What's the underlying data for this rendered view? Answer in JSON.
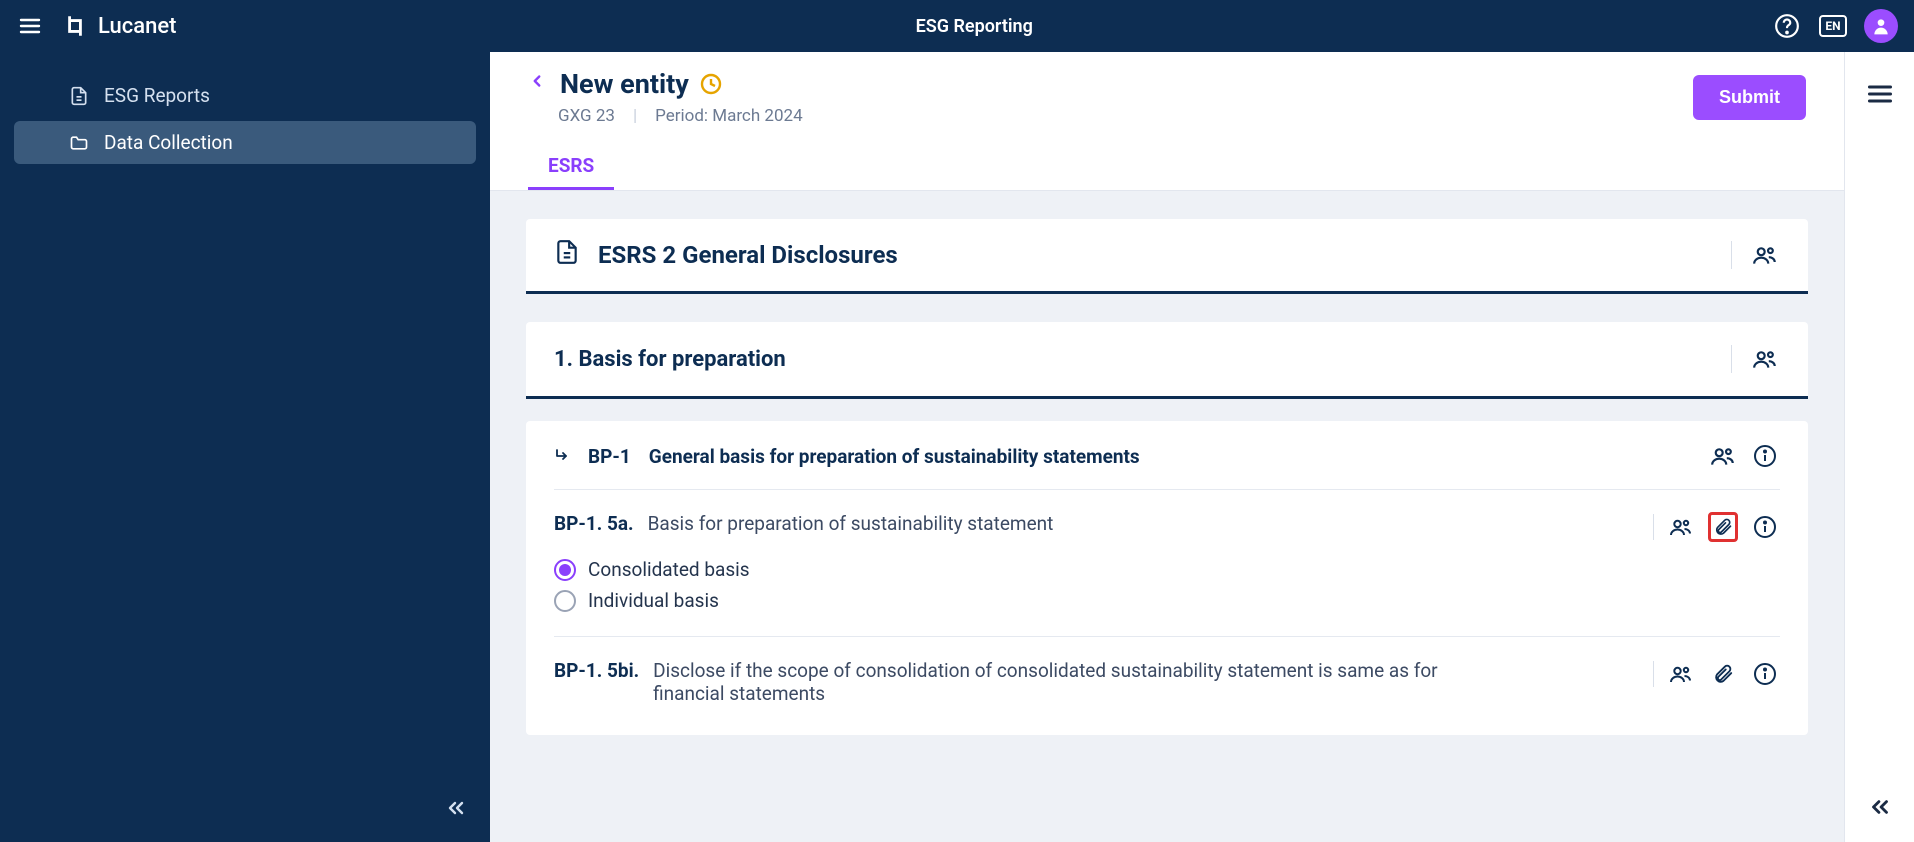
{
  "brand": "Lucanet",
  "app_title": "ESG Reporting",
  "lang": "EN",
  "sidebar": {
    "items": [
      {
        "label": "ESG Reports"
      },
      {
        "label": "Data Collection"
      }
    ]
  },
  "header": {
    "title": "New entity",
    "entity_code": "GXG 23",
    "period_label": "Period: March 2024",
    "submit_label": "Submit"
  },
  "tabs": [
    {
      "label": "ESRS"
    }
  ],
  "section": {
    "title": "ESRS 2 General Disclosures"
  },
  "subsection": {
    "title": "1. Basis for preparation"
  },
  "disclosure": {
    "code": "BP-1",
    "title": "General basis for preparation of sustainability statements"
  },
  "items": [
    {
      "code": "BP-1. 5a.",
      "text": "Basis for preparation of sustainability statement",
      "options": [
        {
          "label": "Consolidated basis",
          "selected": true
        },
        {
          "label": "Individual basis",
          "selected": false
        }
      ],
      "attach_highlight": true
    },
    {
      "code": "BP-1. 5bi.",
      "text": "Disclose if the scope of consolidation of consolidated sustainability statement is same as for financial statements",
      "options": [],
      "attach_highlight": false
    }
  ]
}
